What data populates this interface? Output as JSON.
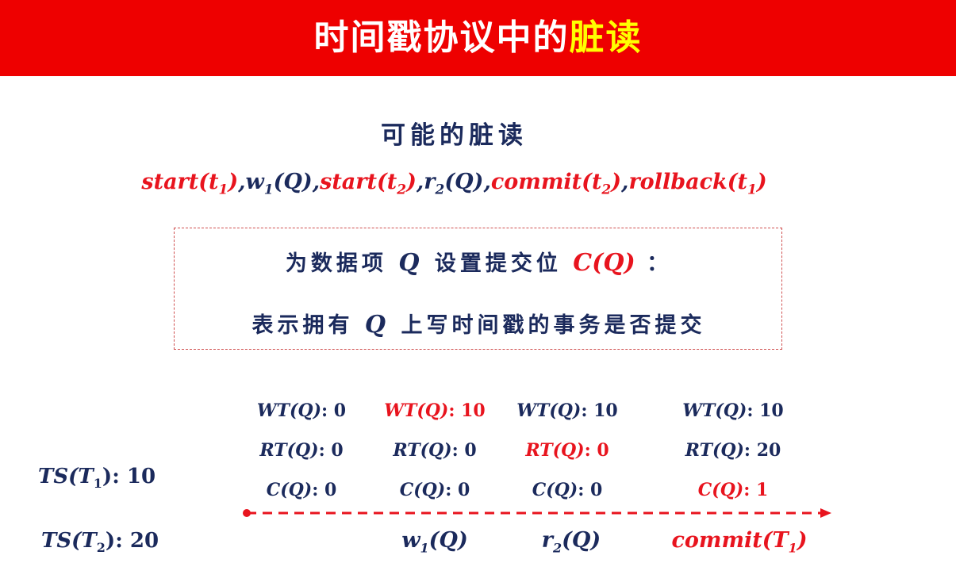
{
  "banner": {
    "title_main": "时间戳协议中的",
    "title_highlight": "脏读"
  },
  "subtitle": "可能的脏读",
  "sequence": [
    {
      "name": "start",
      "sub": "1",
      "arg": "t",
      "color": "red"
    },
    {
      "name": "w",
      "sub": "1",
      "arg": "Q",
      "color": "navy",
      "sub_on_name": true
    },
    {
      "name": "start",
      "sub": "2",
      "arg": "t",
      "color": "red"
    },
    {
      "name": "r",
      "sub": "2",
      "arg": "Q",
      "color": "navy",
      "sub_on_name": true
    },
    {
      "name": "commit",
      "sub": "2",
      "arg": "t",
      "color": "red"
    },
    {
      "name": "rollback",
      "sub": "1",
      "arg": "t",
      "color": "red"
    }
  ],
  "box": {
    "line1_a": "为数据项",
    "line1_q": "Q",
    "line1_b": "设置提交位",
    "line1_c": "C(Q)",
    "line1_d": "：",
    "line2_a": "表示拥有",
    "line2_q": "Q",
    "line2_b": "上写时间戳的事务是否提交"
  },
  "states": [
    {
      "wt": "WT(Q): 0",
      "rt": "RT(Q): 0",
      "c": "C(Q): 0",
      "wt_red": false,
      "rt_red": false,
      "c_red": false
    },
    {
      "wt": "WT(Q): 10",
      "rt": "RT(Q): 0",
      "c": "C(Q): 0",
      "wt_red": true,
      "rt_red": false,
      "c_red": false
    },
    {
      "wt": "WT(Q): 10",
      "rt": "RT(Q): 0",
      "c": "C(Q): 0",
      "wt_red": false,
      "rt_red": true,
      "c_red": false
    },
    {
      "wt": "WT(Q): 10",
      "rt": "RT(Q): 20",
      "c": "C(Q): 1",
      "wt_red": false,
      "rt_red": false,
      "c_red": true
    }
  ],
  "timestamps": {
    "t1_prefix": "TS(T",
    "t1_sub": "1",
    "t1_suffix": "): 10",
    "t2_prefix": "TS(T",
    "t2_sub": "2",
    "t2_suffix": "): 20"
  },
  "operations": {
    "op1_name": "w",
    "op1_sub": "1",
    "op1_arg": "(Q)",
    "op2_name": "r",
    "op2_sub": "2",
    "op2_arg": "(Q)",
    "op3_name": "commit(T",
    "op3_sub": "1",
    "op3_arg": ")"
  },
  "colors": {
    "banner": "#ee0000",
    "highlight": "#ffff00",
    "navy": "#1b2a5c",
    "red": "#e8141e"
  }
}
